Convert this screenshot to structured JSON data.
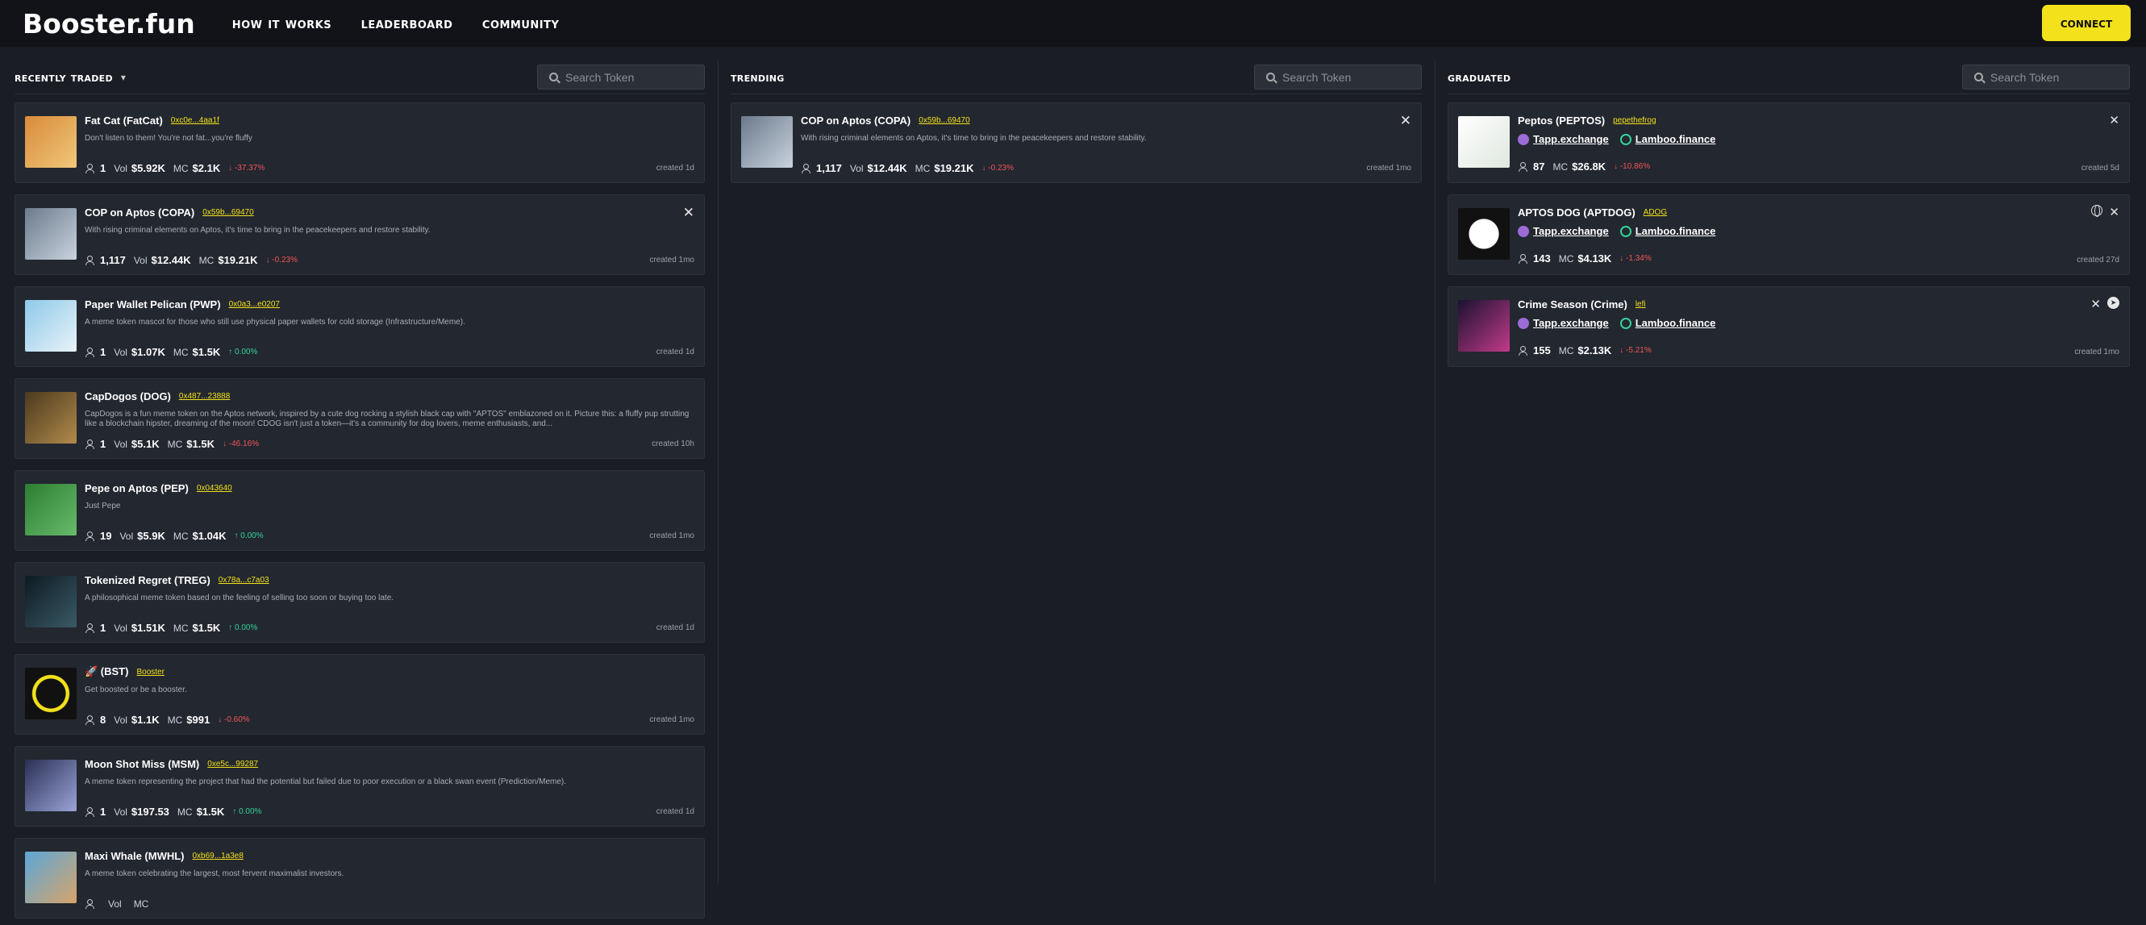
{
  "header": {
    "logo": "Booster.fun",
    "nav": [
      "how it works",
      "leaderboard",
      "community"
    ],
    "connect": "connect"
  },
  "recently_traded": {
    "title": "recently traded",
    "search_placeholder": "Search Token",
    "items": [
      {
        "name": "Fat Cat (FatCat)",
        "addr": "0xc0e...4aa1f",
        "desc": "Don't listen to them! You're not fat...you're fluffy",
        "holders": "1",
        "vol": "$5.92K",
        "mc": "$2.1K",
        "change": "↓ -37.37%",
        "dir": "neg",
        "created": "created 1d",
        "x": false
      },
      {
        "name": "COP on Aptos (COPA)",
        "addr": "0x59b...69470",
        "desc": "With rising criminal elements on Aptos, it's time to bring in the peacekeepers and restore stability.",
        "holders": "1,117",
        "vol": "$12.44K",
        "mc": "$19.21K",
        "change": "↓ -0.23%",
        "dir": "neg",
        "created": "created 1mo",
        "x": true
      },
      {
        "name": "Paper Wallet Pelican (PWP)",
        "addr": "0x0a3...e0207",
        "desc": "A meme token mascot for those who still use physical paper wallets for cold storage (Infrastructure/Meme).",
        "holders": "1",
        "vol": "$1.07K",
        "mc": "$1.5K",
        "change": "↑ 0.00%",
        "dir": "pos",
        "created": "created 1d",
        "x": false
      },
      {
        "name": "CapDogos (DOG)",
        "addr": "0x487...23888",
        "desc": "CapDogos is a fun meme token on the Aptos network, inspired by a cute dog rocking a stylish black cap with \"APTOS\" emblazoned on it. Picture this: a fluffy pup strutting like a blockchain hipster, dreaming of the moon! CDOG isn't just a token—it's a community for dog lovers, meme enthusiasts, and...",
        "holders": "1",
        "vol": "$5.1K",
        "mc": "$1.5K",
        "change": "↓ -46.16%",
        "dir": "neg",
        "created": "created 10h",
        "x": false
      },
      {
        "name": "Pepe on Aptos (PEP)",
        "addr": "0x043640",
        "desc": "Just Pepe",
        "holders": "19",
        "vol": "$5.9K",
        "mc": "$1.04K",
        "change": "↑ 0.00%",
        "dir": "pos",
        "created": "created 1mo",
        "x": false
      },
      {
        "name": "Tokenized Regret (TREG)",
        "addr": "0x78a...c7a03",
        "desc": "A philosophical meme token based on the feeling of selling too soon or buying too late.",
        "holders": "1",
        "vol": "$1.51K",
        "mc": "$1.5K",
        "change": "↑ 0.00%",
        "dir": "pos",
        "created": "created 1d",
        "x": false
      },
      {
        "name": "🚀 (BST)",
        "addr": "Booster",
        "desc": "Get boosted or be a booster.",
        "holders": "8",
        "vol": "$1.1K",
        "mc": "$991",
        "change": "↓ -0.60%",
        "dir": "neg",
        "created": "created 1mo",
        "x": false
      },
      {
        "name": "Moon Shot Miss (MSM)",
        "addr": "0xe5c...99287",
        "desc": "A meme token representing the project that had the potential but failed due to poor execution or a black swan event (Prediction/Meme).",
        "holders": "1",
        "vol": "$197.53",
        "mc": "$1.5K",
        "change": "↑ 0.00%",
        "dir": "pos",
        "created": "created 1d",
        "x": false
      },
      {
        "name": "Maxi Whale (MWHL)",
        "addr": "0xb69...1a3e8",
        "desc": "A meme token celebrating the largest, most fervent maximalist investors.",
        "holders": "",
        "vol": "",
        "mc": "",
        "change": "",
        "dir": "pos",
        "created": "",
        "x": false
      }
    ]
  },
  "trending": {
    "title": "trending",
    "search_placeholder": "Search Token",
    "items": [
      {
        "name": "COP on Aptos (COPA)",
        "addr": "0x59b...69470",
        "desc": "With rising criminal elements on Aptos, it's time to bring in the peacekeepers and restore stability.",
        "holders": "1,117",
        "vol": "$12.44K",
        "mc": "$19.21K",
        "change": "↓ -0.23%",
        "dir": "neg",
        "created": "created 1mo",
        "x": true
      }
    ]
  },
  "graduated": {
    "title": "graduated",
    "search_placeholder": "Search Token",
    "items": [
      {
        "name": "Peptos (PEPTOS)",
        "addr": "pepethefrog",
        "dex": "Tapp.exchange",
        "lam": "Lamboo.finance",
        "holders": "87",
        "mc": "$26.8K",
        "change": "↓ -10.86%",
        "dir": "neg",
        "created": "created 5d",
        "icons": [
          "x"
        ]
      },
      {
        "name": "APTOS DOG (APTDOG)",
        "addr": "ADOG",
        "dex": "Tapp.exchange",
        "lam": "Lamboo.finance",
        "holders": "143",
        "mc": "$4.13K",
        "change": "↓ -1.34%",
        "dir": "neg",
        "created": "created 27d",
        "icons": [
          "globe",
          "x"
        ]
      },
      {
        "name": "Crime Season (Crime)",
        "addr": "lefi",
        "dex": "Tapp.exchange",
        "lam": "Lamboo.finance",
        "holders": "155",
        "mc": "$2.13K",
        "change": "↓ -5.21%",
        "dir": "neg",
        "created": "created 1mo",
        "icons": [
          "x",
          "telegram"
        ]
      }
    ]
  },
  "labels": {
    "vol": "Vol",
    "mc": "MC"
  }
}
